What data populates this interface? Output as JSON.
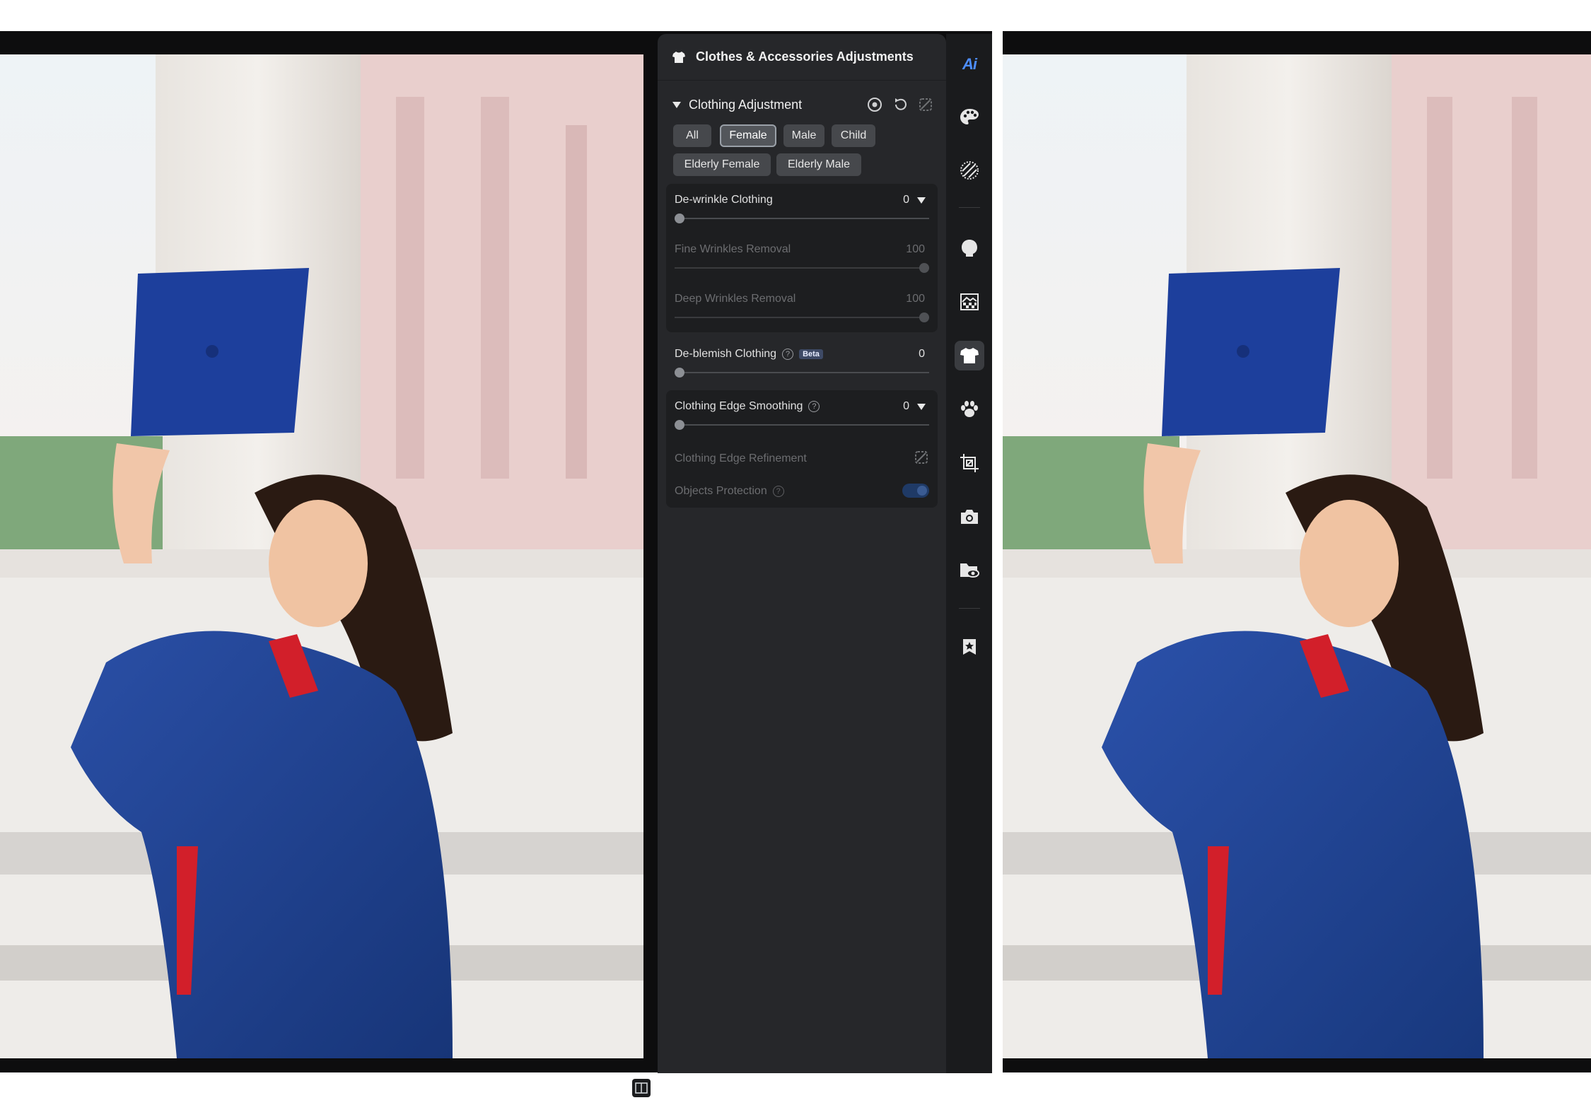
{
  "panel": {
    "title": "Clothes & Accessories Adjustments",
    "section_title": "Clothing Adjustment",
    "filters": [
      {
        "label": "All",
        "active": false
      },
      {
        "label": "Female",
        "active": true
      },
      {
        "label": "Male",
        "active": false
      },
      {
        "label": "Child",
        "active": false
      },
      {
        "label": "Elderly Female",
        "active": false
      },
      {
        "label": "Elderly Male",
        "active": false
      }
    ],
    "dewrinkle": {
      "label": "De-wrinkle Clothing",
      "value": "0",
      "level": 0
    },
    "fine_wrinkles": {
      "label": "Fine Wrinkles Removal",
      "value": "100",
      "level": 100
    },
    "deep_wrinkles": {
      "label": "Deep Wrinkles Removal",
      "value": "100",
      "level": 100
    },
    "deblemish": {
      "label": "De-blemish Clothing",
      "badge": "Beta",
      "value": "0",
      "level": 0
    },
    "edge_smoothing": {
      "label": "Clothing Edge Smoothing",
      "value": "0",
      "level": 0
    },
    "edge_refinement": {
      "label": "Clothing Edge Refinement"
    },
    "objects_protection": {
      "label": "Objects Protection",
      "enabled": true
    }
  },
  "rail": {
    "ai_label": "Ai",
    "icons": [
      "ai-icon",
      "palette-icon",
      "texture-icon",
      "head-icon",
      "background-icon",
      "shirt-icon",
      "paw-icon",
      "crop-icon",
      "camera-icon",
      "folder-eye-icon",
      "bookmark-star-icon"
    ],
    "active": "shirt-icon"
  },
  "colors": {
    "accent": "#4d8dff",
    "panel_bg": "#26272a",
    "gown": "#1f3f8f",
    "stole": "#d21f2a"
  }
}
